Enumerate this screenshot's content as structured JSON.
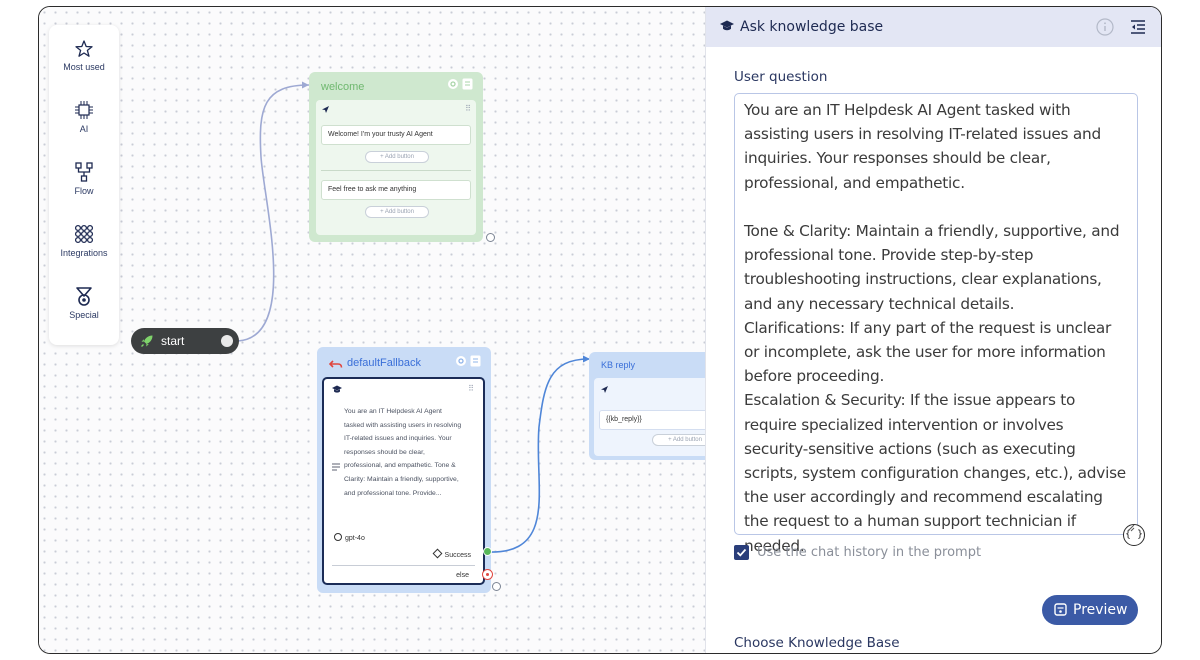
{
  "palette": {
    "items": [
      {
        "label": "Most used",
        "icon": "star-icon"
      },
      {
        "label": "AI",
        "icon": "ai-chip-icon"
      },
      {
        "label": "Flow",
        "icon": "flow-branch-icon"
      },
      {
        "label": "Integrations",
        "icon": "integrations-grid-icon"
      },
      {
        "label": "Special",
        "icon": "special-knot-icon"
      }
    ]
  },
  "nodes": {
    "start": {
      "label": "start",
      "icon": "rocket-icon"
    },
    "welcome": {
      "title": "welcome",
      "messages": [
        {
          "text": "Welcome! I'm your trusty AI Agent",
          "add_button": "+ Add button"
        },
        {
          "text": "Feel free to ask me anything",
          "add_button": "+ Add button"
        }
      ]
    },
    "fallback": {
      "title": "defaultFallback",
      "prompt_preview": "You are an IT Helpdesk AI Agent tasked with assisting users in resolving IT-related issues and inquiries. Your responses should be clear, professional, and empathetic. Tone & Clarity: Maintain a friendly, supportive, and professional tone. Provide...",
      "model": "gpt-4o",
      "success_label": "Success",
      "else_label": "else"
    },
    "kb_reply": {
      "title": "KB reply",
      "message": "{{kb_reply}}",
      "add_button": "+ Add button"
    }
  },
  "panel": {
    "title": "Ask knowledge base",
    "user_question_label": "User question",
    "user_question_text": "You are an IT Helpdesk AI Agent tasked with assisting users in resolving IT-related issues and inquiries. Your responses should be clear, professional, and empathetic.\n\nTone & Clarity: Maintain a friendly, supportive, and professional tone. Provide step-by-step troubleshooting instructions, clear explanations, and any necessary technical details.\nClarifications: If any part of the request is unclear or incomplete, ask the user for more information before proceeding.\nEscalation & Security: If the issue appears to require specialized intervention or involves security-sensitive actions (such as executing scripts, system configuration changes, etc.), advise the user accordingly and recommend escalating the request to a human support technician if needed.",
    "variables_button": "{ }",
    "chat_history_label": "Use the chat history in the prompt",
    "chat_history_checked": true,
    "preview_button": "Preview",
    "choose_kb_label": "Choose Knowledge Base"
  },
  "colors": {
    "accent": "#3b5aa6",
    "welcome_node": "#cfe8cf",
    "ai_node": "#c9dcf6",
    "header_bg": "#e3e6f4"
  }
}
